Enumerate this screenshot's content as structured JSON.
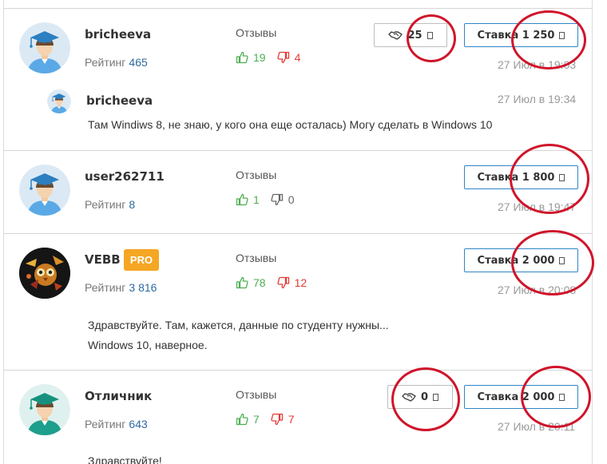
{
  "colors": {
    "accent": "#2f86c6",
    "positive": "#4caf50",
    "negative": "#e53935",
    "pro_badge": "#f5a623",
    "annotation": "#d0142a"
  },
  "reviews_label": "Отзывы",
  "rating_label": "Рейтинг",
  "bids": [
    {
      "username": "bricheeva",
      "rating": "465",
      "likes": "19",
      "dislikes": "4",
      "deal_count": "25",
      "bid_label": "Ставка 1 250",
      "date": "27 Июл в 19:03",
      "reply": {
        "username": "bricheeva",
        "date": "27 Июл в 19:34",
        "text": "Там Windiws 8, не знаю, у кого она еще осталась) Могу сделать в Windows 10"
      }
    },
    {
      "username": "user262711",
      "rating": "8",
      "likes": "1",
      "dislikes": "0",
      "bid_label": "Ставка 1 800",
      "date": "27 Июл в 19:47"
    },
    {
      "username": "VEBB",
      "badge": "PRO",
      "rating": "3 816",
      "likes": "78",
      "dislikes": "12",
      "bid_label": "Ставка 2 000",
      "date": "27 Июл в 20:08",
      "message_lines": [
        "Здравствуйте. Там, кажется, данные по студенту нужны...",
        "Windows 10, наверное."
      ]
    },
    {
      "username": "Отличник",
      "rating": "643",
      "likes": "7",
      "dislikes": "7",
      "deal_count": "0",
      "bid_label": "Ставка 2 000",
      "date": "27 Июл в 20:11",
      "message_lines": [
        "Здравствуйте!"
      ]
    }
  ]
}
